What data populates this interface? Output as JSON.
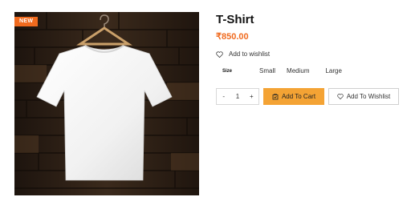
{
  "product": {
    "badge": "NEW",
    "title": "T-Shirt",
    "price": "₹850.00"
  },
  "wishlist_link": {
    "label": "Add to wishlist",
    "icon": "heart-icon"
  },
  "size": {
    "label": "Size",
    "options": [
      "Small",
      "Medium",
      "Large"
    ]
  },
  "quantity": {
    "minus": "-",
    "value": "1",
    "plus": "+"
  },
  "actions": {
    "add_to_cart": "Add To Cart",
    "add_to_wishlist": "Add To Wishlist"
  },
  "colors": {
    "accent": "#f06a1e",
    "cart_button": "#f4a334"
  }
}
